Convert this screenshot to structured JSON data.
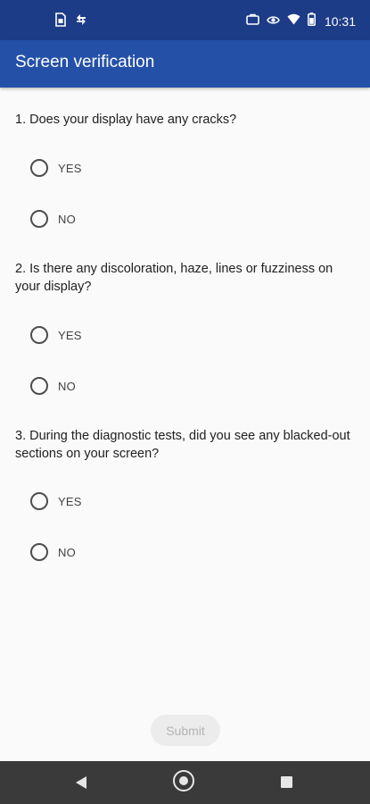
{
  "status_bar": {
    "time": "10:31",
    "left_icons": [
      "sim-card-icon",
      "data-transfer-icon"
    ],
    "right_icons": [
      "briefcase-icon",
      "eye-icon",
      "wifi-icon",
      "battery-icon"
    ]
  },
  "app_bar": {
    "title": "Screen verification"
  },
  "questions": [
    {
      "text": "1. Does your display have any cracks?",
      "options": [
        "YES",
        "NO"
      ]
    },
    {
      "text": "2. Is there any discoloration, haze, lines or fuzziness on your display?",
      "options": [
        "YES",
        "NO"
      ]
    },
    {
      "text": "3. During the diagnostic tests, did you see any blacked-out sections on your screen?",
      "options": [
        "YES",
        "NO"
      ]
    }
  ],
  "submit": {
    "label": "Submit",
    "enabled": false
  },
  "nav_bar": {
    "icons": [
      "back-icon",
      "home-icon",
      "recents-icon"
    ]
  },
  "colors": {
    "status_bar": "#1d3c87",
    "app_bar": "#2450a8",
    "background": "#fafafa",
    "nav_bar": "#3a3a3a"
  }
}
